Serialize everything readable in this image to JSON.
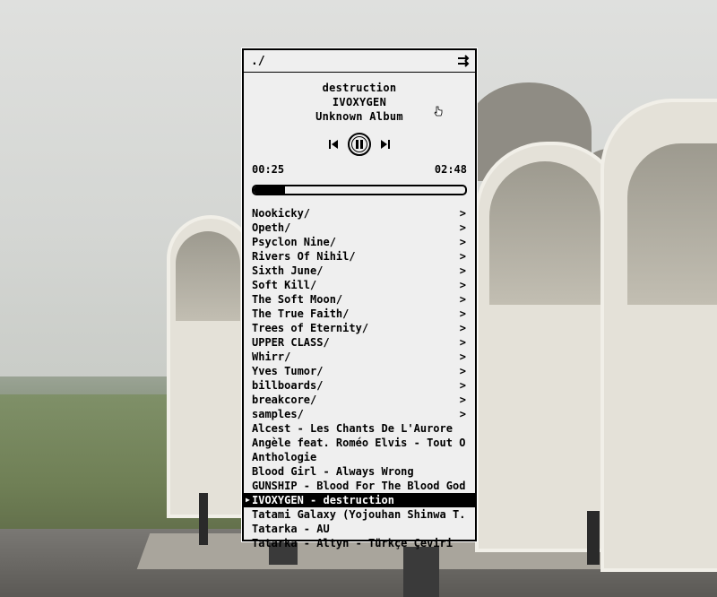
{
  "window": {
    "path": "./",
    "shuffle_icon": "shuffle-arrows-icon"
  },
  "now_playing": {
    "title": "destruction",
    "artist": "IVOXYGEN",
    "album": "Unknown Album",
    "elapsed": "00:25",
    "duration": "02:48",
    "progress_fraction": 0.149
  },
  "controls": {
    "prev_icon": "skip-previous-icon",
    "pause_icon": "pause-icon",
    "next_icon": "skip-next-icon"
  },
  "folders": [
    "Nookicky/",
    "Opeth/",
    "Psyclon Nine/",
    "Rivers Of Nihil/",
    "Sixth June/",
    "Soft Kill/",
    "The Soft Moon/",
    "The True Faith/",
    "Trees of Eternity/",
    "UPPER CLASS/",
    "Whirr/",
    "Yves Tumor/",
    "billboards/",
    "breakcore/",
    "samples/"
  ],
  "files": [
    "Alcest - Les Chants De L'Aurore",
    "Angèle feat. Roméo Elvis - Tout Ou..",
    "Anthologie",
    "Blood Girl - Always Wrong",
    "GUNSHIP - Blood For The Blood God..",
    "IVOXYGEN - destruction",
    "Tatami Galaxy (Yojouhan Shinwa T..",
    "Tatarka - AU",
    "Tatarka - Altyn - Türkçe Çeviri"
  ],
  "folder_chevron": ">",
  "active_marker": "▶",
  "active_file_index": 5
}
